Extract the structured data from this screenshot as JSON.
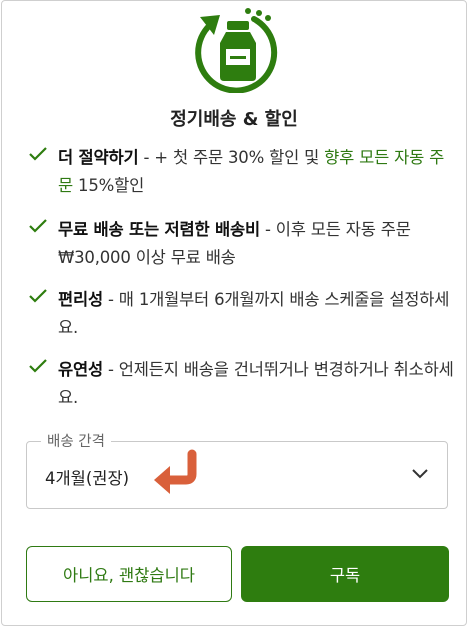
{
  "dialog": {
    "title": "정기배송 & 할인"
  },
  "benefits": [
    {
      "bold": "더 절약하기",
      "text_a": " - + 첫 주문 30% 할인 및 ",
      "highlight": "향후 모든 자동 주문",
      "text_b": " 15%할인"
    },
    {
      "bold": "무료 배송 또는 저렴한 배송비",
      "text_a": " - 이후 모든 자동 주문 ₩30,000 이상 무료 배송"
    },
    {
      "bold": "편리성",
      "text_a": " - 매 1개월부터 6개월까지 배송 스케줄을 설정하세요."
    },
    {
      "bold": "유연성",
      "text_a": " - 언제든지 배송을 건너뛰거나 변경하거나 취소하세요."
    }
  ],
  "interval": {
    "label": "배송 간격",
    "value": "4개월(권장)"
  },
  "buttons": {
    "decline": "아니요, 괜찮습니다",
    "subscribe": "구독"
  },
  "colors": {
    "brand_green": "#2e7d0f",
    "annotation_arrow": "#d9603b"
  }
}
